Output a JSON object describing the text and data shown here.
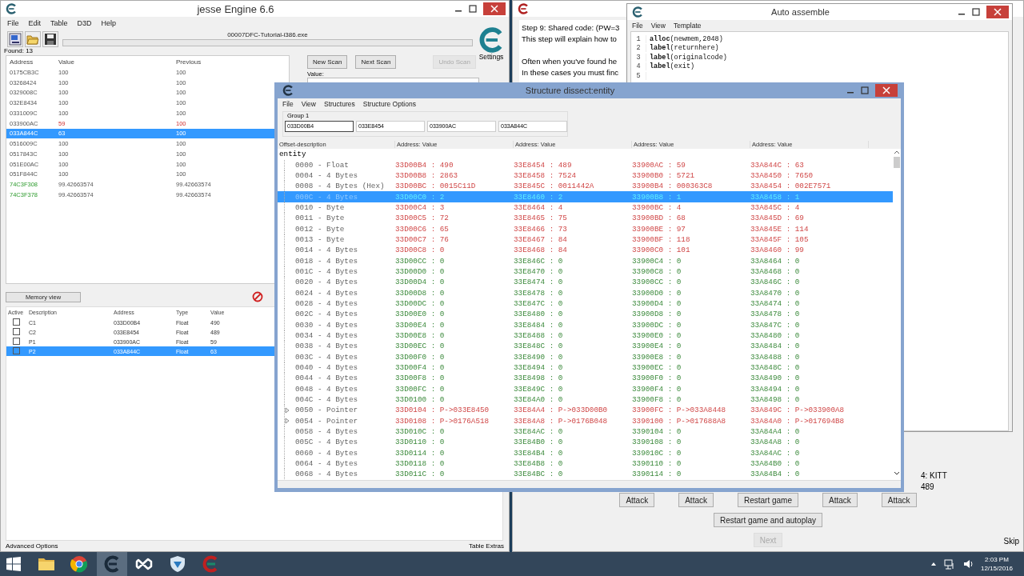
{
  "main_window": {
    "title": "jesse Engine 6.6",
    "menu": [
      "File",
      "Edit",
      "Table",
      "D3D",
      "Help"
    ],
    "process": "00007DFC-Tutorial-i386.exe",
    "found": "Found: 13",
    "scan_columns": [
      "Address",
      "Value",
      "Previous"
    ],
    "scan_results": [
      {
        "address": "0175CB3C",
        "value": "100",
        "previous": "100",
        "kind": "normal",
        "selected": false
      },
      {
        "address": "03268424",
        "value": "100",
        "previous": "100",
        "kind": "normal",
        "selected": false
      },
      {
        "address": "0329008C",
        "value": "100",
        "previous": "100",
        "kind": "normal",
        "selected": false
      },
      {
        "address": "032E8434",
        "value": "100",
        "previous": "100",
        "kind": "normal",
        "selected": false
      },
      {
        "address": "0331009C",
        "value": "100",
        "previous": "100",
        "kind": "normal",
        "selected": false
      },
      {
        "address": "033900AC",
        "value": "59",
        "previous": "100",
        "kind": "changed",
        "selected": false
      },
      {
        "address": "033A844C",
        "value": "63",
        "previous": "100",
        "kind": "changed",
        "selected": true
      },
      {
        "address": "0516009C",
        "value": "100",
        "previous": "100",
        "kind": "normal",
        "selected": false
      },
      {
        "address": "0517843C",
        "value": "100",
        "previous": "100",
        "kind": "normal",
        "selected": false
      },
      {
        "address": "051E00AC",
        "value": "100",
        "previous": "100",
        "kind": "normal",
        "selected": false
      },
      {
        "address": "051F844C",
        "value": "100",
        "previous": "100",
        "kind": "normal",
        "selected": false
      },
      {
        "address": "74C3F308",
        "value": "99.42663574",
        "previous": "99.42663574",
        "kind": "static",
        "selected": false
      },
      {
        "address": "74C3F378",
        "value": "99.42663574",
        "previous": "99.42663574",
        "kind": "static",
        "selected": false
      }
    ],
    "scan_buttons": [
      {
        "label": "New Scan",
        "disabled": false
      },
      {
        "label": "Next Scan",
        "disabled": false
      },
      {
        "label": "Undo Scan",
        "disabled": true
      }
    ],
    "settings_label": "Settings",
    "value_label": "Value:",
    "progress": {
      "level": 0
    },
    "memory_view_button": "Memory view",
    "table_columns": [
      "Active",
      "Description",
      "Address",
      "Type",
      "Value"
    ],
    "cheat_table": [
      {
        "active": false,
        "description": "C1",
        "address": "033D00B4",
        "type": "Float",
        "value": "490",
        "selected": false
      },
      {
        "active": false,
        "description": "C2",
        "address": "033E8454",
        "type": "Float",
        "value": "489",
        "selected": false
      },
      {
        "active": false,
        "description": "P1",
        "address": "033900AC",
        "type": "Float",
        "value": "59",
        "selected": false
      },
      {
        "active": false,
        "description": "P2",
        "address": "033A844C",
        "type": "Float",
        "value": "63",
        "selected": true
      }
    ],
    "advanced_options": "Advanced Options",
    "table_extras": "Table Extras"
  },
  "tutorial_window": {
    "paragraphs": [
      [
        "Step 9: Shared code: (PW=3",
        "This step will explain how to"
      ],
      [
        "Often when you've found he",
        "In these cases you must finc"
      ]
    ],
    "player_labels": [
      "4: KITT",
      "489"
    ],
    "game_buttons": [
      "Attack",
      "Attack",
      "Restart game",
      "Attack",
      "Attack"
    ],
    "autoplay_button": "Restart game and autoplay",
    "next_button": {
      "label": "Next",
      "disabled": true
    },
    "skip": "Skip"
  },
  "auto_assemble": {
    "title": "Auto assemble",
    "menu": [
      "File",
      "View",
      "Template"
    ],
    "lines": [
      {
        "number": "1",
        "code": "**alloc**(newmem,2048)"
      },
      {
        "number": "2",
        "code": "**label**(returnhere)"
      },
      {
        "number": "3",
        "code": "**label**(originalcode)"
      },
      {
        "number": "4",
        "code": "**label**(exit)"
      },
      {
        "number": "5"
      }
    ]
  },
  "structure_dissect": {
    "title": "Structure dissect:entity",
    "menu": [
      "File",
      "View",
      "Structures",
      "Structure Options"
    ],
    "group_label": "Group 1",
    "addresses": [
      {
        "value": "033D00B4",
        "selected": true
      },
      {
        "value": "033E8454",
        "selected": false
      },
      {
        "value": "033900AC",
        "selected": false
      },
      {
        "value": "033A844C",
        "selected": false
      }
    ],
    "offset_column": "Offset-description",
    "value_columns": [
      "Address: Value",
      "Address: Value",
      "Address: Value",
      "Address: Value"
    ],
    "root": "entity",
    "rows": [
      {
        "offset": "0000 - Float",
        "kind": "value",
        "differs": true,
        "selected": false,
        "cells": [
          "33D00B4 : 490",
          "33E8454 : 489",
          "33900AC : 59",
          "33A844C : 63"
        ]
      },
      {
        "offset": "0004 - 4 Bytes",
        "kind": "value",
        "differs": true,
        "selected": false,
        "cells": [
          "33D00B8 : 2863",
          "33E8458 : 7524",
          "33900B0 : 5721",
          "33A8450 : 7650"
        ]
      },
      {
        "offset": "0008 - 4 Bytes (Hex)",
        "kind": "value",
        "differs": true,
        "selected": false,
        "cells": [
          "33D00BC : 0015C11D",
          "33E845C : 0011442A",
          "33900B4 : 000363C8",
          "33A8454 : 002E7571"
        ]
      },
      {
        "offset": "000C - 4 Bytes",
        "kind": "value",
        "differs": true,
        "selected": true,
        "cells": [
          "33D00C0 : 2",
          "33E8460 : 2",
          "33900B8 : 1",
          "33A8458 : 1"
        ]
      },
      {
        "offset": "0010 - Byte",
        "kind": "value",
        "differs": true,
        "selected": false,
        "cells": [
          "33D00C4 : 3",
          "33E8464 : 4",
          "33900BC : 4",
          "33A845C : 4"
        ]
      },
      {
        "offset": "0011 - Byte",
        "kind": "value",
        "differs": true,
        "selected": false,
        "cells": [
          "33D00C5 : 72",
          "33E8465 : 75",
          "33900BD : 68",
          "33A845D : 69"
        ]
      },
      {
        "offset": "0012 - Byte",
        "kind": "value",
        "differs": true,
        "selected": false,
        "cells": [
          "33D00C6 : 65",
          "33E8466 : 73",
          "33900BE : 97",
          "33A845E : 114"
        ]
      },
      {
        "offset": "0013 - Byte",
        "kind": "value",
        "differs": true,
        "selected": false,
        "cells": [
          "33D00C7 : 76",
          "33E8467 : 84",
          "33900BF : 118",
          "33A845F : 105"
        ]
      },
      {
        "offset": "0014 - 4 Bytes",
        "kind": "value",
        "differs": true,
        "selected": false,
        "cells": [
          "33D00C8 : 0",
          "33E8468 : 84",
          "33900C0 : 101",
          "33A8460 : 99"
        ]
      },
      {
        "offset": "0018 - 4 Bytes",
        "kind": "value",
        "differs": false,
        "selected": false,
        "cells": [
          "33D00CC : 0",
          "33E846C : 0",
          "33900C4 : 0",
          "33A8464 : 0"
        ]
      },
      {
        "offset": "001C - 4 Bytes",
        "kind": "value",
        "differs": false,
        "selected": false,
        "cells": [
          "33D00D0 : 0",
          "33E8470 : 0",
          "33900C8 : 0",
          "33A8468 : 0"
        ]
      },
      {
        "offset": "0020 - 4 Bytes",
        "kind": "value",
        "differs": false,
        "selected": false,
        "cells": [
          "33D00D4 : 0",
          "33E8474 : 0",
          "33900CC : 0",
          "33A846C : 0"
        ]
      },
      {
        "offset": "0024 - 4 Bytes",
        "kind": "value",
        "differs": false,
        "selected": false,
        "cells": [
          "33D00D8 : 0",
          "33E8478 : 0",
          "33900D0 : 0",
          "33A8470 : 0"
        ]
      },
      {
        "offset": "0028 - 4 Bytes",
        "kind": "value",
        "differs": false,
        "selected": false,
        "cells": [
          "33D00DC : 0",
          "33E847C : 0",
          "33900D4 : 0",
          "33A8474 : 0"
        ]
      },
      {
        "offset": "002C - 4 Bytes",
        "kind": "value",
        "differs": false,
        "selected": false,
        "cells": [
          "33D00E0 : 0",
          "33E8480 : 0",
          "33900D8 : 0",
          "33A8478 : 0"
        ]
      },
      {
        "offset": "0030 - 4 Bytes",
        "kind": "value",
        "differs": false,
        "selected": false,
        "cells": [
          "33D00E4 : 0",
          "33E8484 : 0",
          "33900DC : 0",
          "33A847C : 0"
        ]
      },
      {
        "offset": "0034 - 4 Bytes",
        "kind": "value",
        "differs": false,
        "selected": false,
        "cells": [
          "33D00E8 : 0",
          "33E8488 : 0",
          "33900E0 : 0",
          "33A8480 : 0"
        ]
      },
      {
        "offset": "0038 - 4 Bytes",
        "kind": "value",
        "differs": false,
        "selected": false,
        "cells": [
          "33D00EC : 0",
          "33E848C : 0",
          "33900E4 : 0",
          "33A8484 : 0"
        ]
      },
      {
        "offset": "003C - 4 Bytes",
        "kind": "value",
        "differs": false,
        "selected": false,
        "cells": [
          "33D00F0 : 0",
          "33E8490 : 0",
          "33900E8 : 0",
          "33A8488 : 0"
        ]
      },
      {
        "offset": "0040 - 4 Bytes",
        "kind": "value",
        "differs": false,
        "selected": false,
        "cells": [
          "33D00F4 : 0",
          "33E8494 : 0",
          "33900EC : 0",
          "33A848C : 0"
        ]
      },
      {
        "offset": "0044 - 4 Bytes",
        "kind": "value",
        "differs": false,
        "selected": false,
        "cells": [
          "33D00F8 : 0",
          "33E8498 : 0",
          "33900F0 : 0",
          "33A8490 : 0"
        ]
      },
      {
        "offset": "0048 - 4 Bytes",
        "kind": "value",
        "differs": false,
        "selected": false,
        "cells": [
          "33D00FC : 0",
          "33E849C : 0",
          "33900F4 : 0",
          "33A8494 : 0"
        ]
      },
      {
        "offset": "004C - 4 Bytes",
        "kind": "value",
        "differs": false,
        "selected": false,
        "cells": [
          "33D0100 : 0",
          "33E84A0 : 0",
          "33900F8 : 0",
          "33A8498 : 0"
        ]
      },
      {
        "offset": "0050 - Pointer",
        "kind": "pointer",
        "differs": true,
        "selected": false,
        "cells": [
          "33D0104 : P->033E8450",
          "33E84A4 : P->033D00B0",
          "33900FC : P->033A8448",
          "33A849C : P->033900A8"
        ]
      },
      {
        "offset": "0054 - Pointer",
        "kind": "pointer",
        "differs": true,
        "selected": false,
        "cells": [
          "33D0108 : P->0176A518",
          "33E84A8 : P->0176B048",
          "3390100 : P->017688A8",
          "33A84A0 : P->017694B8"
        ]
      },
      {
        "offset": "0058 - 4 Bytes",
        "kind": "value",
        "differs": false,
        "selected": false,
        "cells": [
          "33D010C : 0",
          "33E84AC : 0",
          "3390104 : 0",
          "33A84A4 : 0"
        ]
      },
      {
        "offset": "005C - 4 Bytes",
        "kind": "value",
        "differs": false,
        "selected": false,
        "cells": [
          "33D0110 : 0",
          "33E84B0 : 0",
          "3390108 : 0",
          "33A84A8 : 0"
        ]
      },
      {
        "offset": "0060 - 4 Bytes",
        "kind": "value",
        "differs": false,
        "selected": false,
        "cells": [
          "33D0114 : 0",
          "33E84B4 : 0",
          "339010C : 0",
          "33A84AC : 0"
        ]
      },
      {
        "offset": "0064 - 4 Bytes",
        "kind": "value",
        "differs": false,
        "selected": false,
        "cells": [
          "33D0118 : 0",
          "33E84B8 : 0",
          "3390110 : 0",
          "33A84B0 : 0"
        ]
      },
      {
        "offset": "0068 - 4 Bytes",
        "kind": "value",
        "differs": false,
        "selected": false,
        "cells": [
          "33D011C : 0",
          "33E84BC : 0",
          "3390114 : 0",
          "33A84B4 : 0"
        ]
      }
    ]
  },
  "taskbar": {
    "apps": [
      {
        "kind": "folder",
        "active": false
      },
      {
        "kind": "browser",
        "active": false
      },
      {
        "kind": "engine",
        "active": true
      },
      {
        "kind": "studio",
        "active": false
      },
      {
        "kind": "shield",
        "active": false
      },
      {
        "kind": "engine-red",
        "active": false
      }
    ],
    "time": "2:03 PM",
    "date": "12/15/2016"
  }
}
